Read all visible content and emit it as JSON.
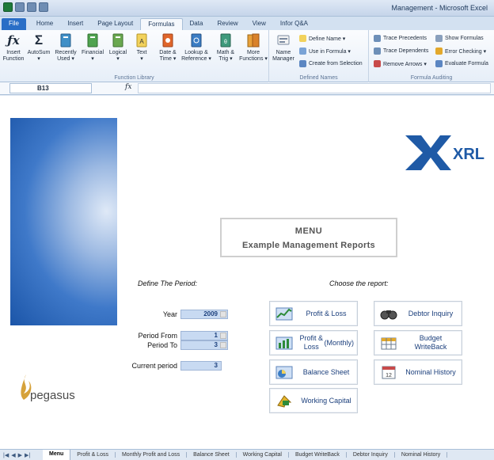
{
  "window": {
    "title": "Management - Microsoft Excel"
  },
  "ribbon": {
    "tabs": [
      "File",
      "Home",
      "Insert",
      "Page Layout",
      "Formulas",
      "Data",
      "Review",
      "View",
      "Infor Q&A"
    ],
    "active_tab": "Formulas",
    "function_library": {
      "label": "Function Library",
      "buttons": [
        {
          "line1": "Insert",
          "line2": "Function"
        },
        {
          "line1": "AutoSum",
          "line2": "▾"
        },
        {
          "line1": "Recently",
          "line2": "Used ▾"
        },
        {
          "line1": "Financial",
          "line2": "▾"
        },
        {
          "line1": "Logical",
          "line2": "▾"
        },
        {
          "line1": "Text",
          "line2": "▾"
        },
        {
          "line1": "Date &",
          "line2": "Time ▾"
        },
        {
          "line1": "Lookup &",
          "line2": "Reference ▾"
        },
        {
          "line1": "Math &",
          "line2": "Trig ▾"
        },
        {
          "line1": "More",
          "line2": "Functions ▾"
        }
      ]
    },
    "defined_names": {
      "label": "Defined Names",
      "manager_line1": "Name",
      "manager_line2": "Manager",
      "define_name": "Define Name ▾",
      "use_in_formula": "Use in Formula ▾",
      "create_from_selection": "Create from Selection"
    },
    "formula_auditing": {
      "label": "Formula Auditing",
      "trace_precedents": "Trace Precedents",
      "trace_dependents": "Trace Dependents",
      "remove_arrows": "Remove Arrows ▾",
      "show_formulas": "Show Formulas",
      "error_checking": "Error Checking ▾",
      "evaluate_formula": "Evaluate Formula"
    }
  },
  "formula_bar": {
    "cell_ref": "B13",
    "fx": "fx",
    "value": ""
  },
  "sheet": {
    "xrl_logo_text": "XRL",
    "pegasus_logo_text": "pegasus",
    "menu_title": "MENU",
    "menu_subtitle": "Example Management Reports",
    "define_period_header": "Define The Period:",
    "choose_report_header": "Choose the report:",
    "year_label": "Year",
    "year_value": "2009",
    "period_from_label": "Period From",
    "period_from_value": "1",
    "period_to_label": "Period To",
    "period_to_value": "3",
    "current_period_label": "Current period",
    "current_period_value": "3",
    "reports": {
      "profit_loss": "Profit & Loss",
      "profit_loss_monthly_1": "Profit & Loss",
      "profit_loss_monthly_2": "(Monthly)",
      "balance_sheet": "Balance Sheet",
      "working_capital": "Working Capital",
      "debtor_inquiry": "Debtor Inquiry",
      "budget_writeback": "Budget WriteBack",
      "nominal_history": "Nominal History"
    }
  },
  "sheet_tabs": [
    "Menu",
    "Profit & Loss",
    "Monthly Profit and Loss",
    "Balance Sheet",
    "Working Capital",
    "Budget WriteBack",
    "Debtor Inquiry",
    "Nominal History"
  ],
  "icons": {
    "nav_first": "first-sheet-icon",
    "nav_prev": "prev-sheet-icon",
    "nav_next": "next-sheet-icon",
    "nav_last": "last-sheet-icon"
  },
  "colors": {
    "file_tab": "#2a6ec6",
    "input_fill": "#c8daf2",
    "xrl_logo_blue": "#1f5aa6",
    "report_text": "#1b3f7c"
  }
}
